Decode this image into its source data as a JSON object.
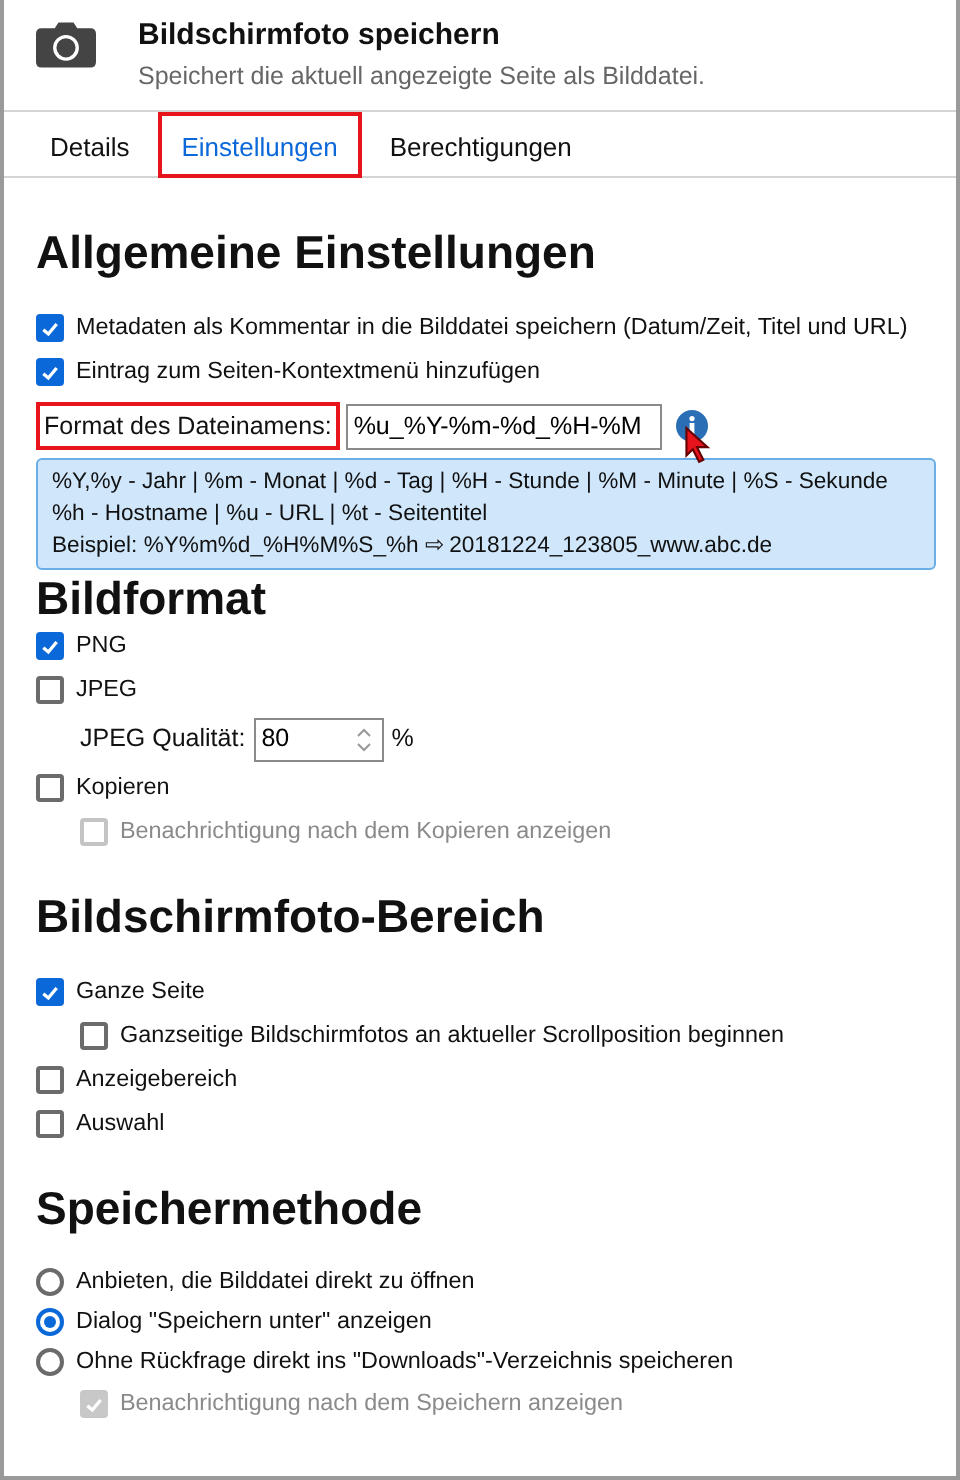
{
  "header": {
    "title": "Bildschirmfoto speichern",
    "subtitle": "Speichert die aktuell angezeigte Seite als Bilddatei."
  },
  "tabs": [
    {
      "label": "Details",
      "selected": false,
      "highlighted": false
    },
    {
      "label": "Einstellungen",
      "selected": true,
      "highlighted": true
    },
    {
      "label": "Berechtigungen",
      "selected": false,
      "highlighted": false
    }
  ],
  "sections": [
    {
      "title": "Allgemeine Einstellungen",
      "items": [
        {
          "kind": "checkbox",
          "label": "Metadaten als Kommentar in die Bilddatei speichern (Datum/Zeit, Titel und URL)",
          "checked": true,
          "disabled": false
        },
        {
          "kind": "checkbox",
          "label": "Eintrag zum Seiten-Kontextmenü hinzufügen",
          "checked": true,
          "disabled": false
        },
        {
          "kind": "text_field",
          "label": "Format des Dateinamens:",
          "value": "%u_%Y-%m-%d_%H-%M",
          "highlighted": true,
          "tooltip": [
            "%Y,%y - Jahr | %m - Monat | %d - Tag | %H - Stunde | %M - Minute | %S - Sekunde",
            "%h - Hostname | %u - URL | %t - Seitentitel",
            "Beispiel: %Y%m%d_%H%M%S_%h ⇨ 20181224_123805_www.abc.de"
          ]
        }
      ]
    },
    {
      "title": "Bildformat",
      "items": [
        {
          "kind": "checkbox",
          "label": "PNG",
          "checked": true,
          "disabled": false
        },
        {
          "kind": "checkbox",
          "label": "JPEG",
          "checked": false,
          "disabled": false
        },
        {
          "kind": "number_field",
          "label": "JPEG Qualität:",
          "value": "80",
          "unit": "%"
        },
        {
          "kind": "checkbox",
          "label": "Kopieren",
          "checked": false,
          "disabled": false,
          "children": [
            {
              "kind": "checkbox",
              "label": "Benachrichtigung nach dem Kopieren anzeigen",
              "checked": false,
              "disabled": true
            }
          ]
        }
      ]
    },
    {
      "title": "Bildschirmfoto-Bereich",
      "items": [
        {
          "kind": "checkbox",
          "label": "Ganze Seite",
          "checked": true,
          "disabled": false,
          "children": [
            {
              "kind": "checkbox",
              "label": "Ganzseitige Bildschirmfotos an aktueller Scrollposition beginnen",
              "checked": false,
              "disabled": false
            }
          ]
        },
        {
          "kind": "checkbox",
          "label": "Anzeigebereich",
          "checked": false,
          "disabled": false
        },
        {
          "kind": "checkbox",
          "label": "Auswahl",
          "checked": false,
          "disabled": false
        }
      ]
    },
    {
      "title": "Speichermethode",
      "items": [
        {
          "kind": "radio",
          "label": "Anbieten, die Bilddatei direkt zu öffnen",
          "selected": false
        },
        {
          "kind": "radio",
          "label": "Dialog \"Speichern unter\" anzeigen",
          "selected": true
        },
        {
          "kind": "radio",
          "label": "Ohne Rückfrage direkt ins \"Downloads\"-Verzeichnis speicheren",
          "selected": false,
          "children": [
            {
              "kind": "checkbox",
              "label": "Benachrichtigung nach dem Speichern anzeigen",
              "checked": true,
              "disabled": true
            }
          ]
        }
      ]
    }
  ]
}
